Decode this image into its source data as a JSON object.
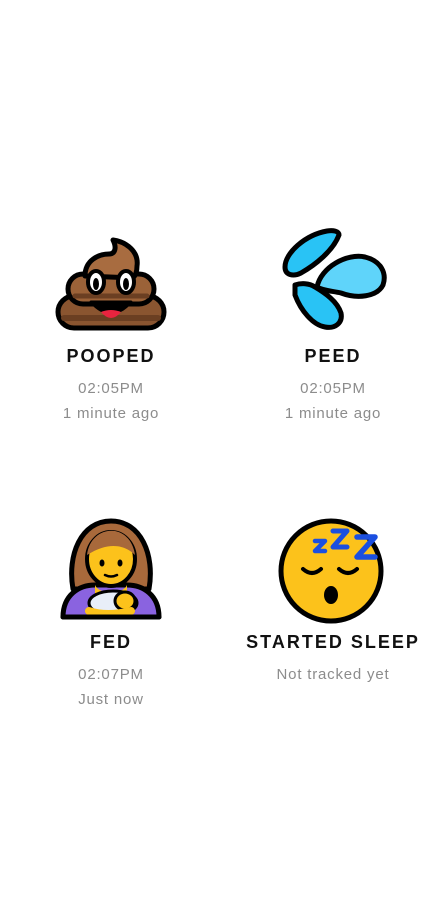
{
  "tiles": {
    "pooped": {
      "label": "POOPED",
      "time": "02:05PM",
      "ago": "1 minute ago",
      "icon": "pile-of-poo-icon"
    },
    "peed": {
      "label": "PEED",
      "time": "02:05PM",
      "ago": "1 minute ago",
      "icon": "sweat-droplets-icon"
    },
    "fed": {
      "label": "FED",
      "time": "02:07PM",
      "ago": "Just now",
      "icon": "breast-feeding-icon"
    },
    "sleep": {
      "label": "STARTED SLEEP",
      "status": "Not tracked yet",
      "icon": "sleeping-face-icon"
    }
  },
  "colors": {
    "label": "#111111",
    "meta": "#8c8c8c",
    "poo": "#8a5530",
    "water": "#29c3f5",
    "skin": "#fcc21b",
    "hair": "#a8693b",
    "shirt": "#8a63e0",
    "zzz": "#1b4fe0"
  }
}
